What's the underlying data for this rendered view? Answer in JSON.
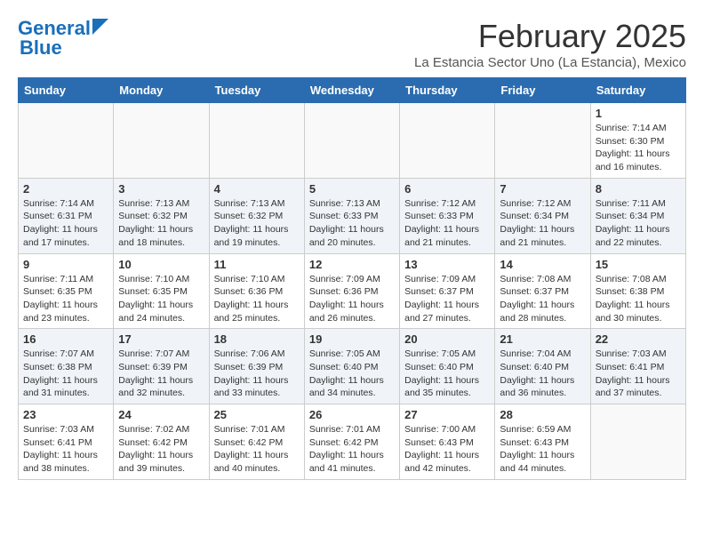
{
  "logo": {
    "line1": "General",
    "line2": "Blue"
  },
  "title": "February 2025",
  "location": "La Estancia Sector Uno (La Estancia), Mexico",
  "days_of_week": [
    "Sunday",
    "Monday",
    "Tuesday",
    "Wednesday",
    "Thursday",
    "Friday",
    "Saturday"
  ],
  "weeks": [
    [
      {
        "day": "",
        "info": ""
      },
      {
        "day": "",
        "info": ""
      },
      {
        "day": "",
        "info": ""
      },
      {
        "day": "",
        "info": ""
      },
      {
        "day": "",
        "info": ""
      },
      {
        "day": "",
        "info": ""
      },
      {
        "day": "1",
        "info": "Sunrise: 7:14 AM\nSunset: 6:30 PM\nDaylight: 11 hours\nand 16 minutes."
      }
    ],
    [
      {
        "day": "2",
        "info": "Sunrise: 7:14 AM\nSunset: 6:31 PM\nDaylight: 11 hours\nand 17 minutes."
      },
      {
        "day": "3",
        "info": "Sunrise: 7:13 AM\nSunset: 6:32 PM\nDaylight: 11 hours\nand 18 minutes."
      },
      {
        "day": "4",
        "info": "Sunrise: 7:13 AM\nSunset: 6:32 PM\nDaylight: 11 hours\nand 19 minutes."
      },
      {
        "day": "5",
        "info": "Sunrise: 7:13 AM\nSunset: 6:33 PM\nDaylight: 11 hours\nand 20 minutes."
      },
      {
        "day": "6",
        "info": "Sunrise: 7:12 AM\nSunset: 6:33 PM\nDaylight: 11 hours\nand 21 minutes."
      },
      {
        "day": "7",
        "info": "Sunrise: 7:12 AM\nSunset: 6:34 PM\nDaylight: 11 hours\nand 21 minutes."
      },
      {
        "day": "8",
        "info": "Sunrise: 7:11 AM\nSunset: 6:34 PM\nDaylight: 11 hours\nand 22 minutes."
      }
    ],
    [
      {
        "day": "9",
        "info": "Sunrise: 7:11 AM\nSunset: 6:35 PM\nDaylight: 11 hours\nand 23 minutes."
      },
      {
        "day": "10",
        "info": "Sunrise: 7:10 AM\nSunset: 6:35 PM\nDaylight: 11 hours\nand 24 minutes."
      },
      {
        "day": "11",
        "info": "Sunrise: 7:10 AM\nSunset: 6:36 PM\nDaylight: 11 hours\nand 25 minutes."
      },
      {
        "day": "12",
        "info": "Sunrise: 7:09 AM\nSunset: 6:36 PM\nDaylight: 11 hours\nand 26 minutes."
      },
      {
        "day": "13",
        "info": "Sunrise: 7:09 AM\nSunset: 6:37 PM\nDaylight: 11 hours\nand 27 minutes."
      },
      {
        "day": "14",
        "info": "Sunrise: 7:08 AM\nSunset: 6:37 PM\nDaylight: 11 hours\nand 28 minutes."
      },
      {
        "day": "15",
        "info": "Sunrise: 7:08 AM\nSunset: 6:38 PM\nDaylight: 11 hours\nand 30 minutes."
      }
    ],
    [
      {
        "day": "16",
        "info": "Sunrise: 7:07 AM\nSunset: 6:38 PM\nDaylight: 11 hours\nand 31 minutes."
      },
      {
        "day": "17",
        "info": "Sunrise: 7:07 AM\nSunset: 6:39 PM\nDaylight: 11 hours\nand 32 minutes."
      },
      {
        "day": "18",
        "info": "Sunrise: 7:06 AM\nSunset: 6:39 PM\nDaylight: 11 hours\nand 33 minutes."
      },
      {
        "day": "19",
        "info": "Sunrise: 7:05 AM\nSunset: 6:40 PM\nDaylight: 11 hours\nand 34 minutes."
      },
      {
        "day": "20",
        "info": "Sunrise: 7:05 AM\nSunset: 6:40 PM\nDaylight: 11 hours\nand 35 minutes."
      },
      {
        "day": "21",
        "info": "Sunrise: 7:04 AM\nSunset: 6:40 PM\nDaylight: 11 hours\nand 36 minutes."
      },
      {
        "day": "22",
        "info": "Sunrise: 7:03 AM\nSunset: 6:41 PM\nDaylight: 11 hours\nand 37 minutes."
      }
    ],
    [
      {
        "day": "23",
        "info": "Sunrise: 7:03 AM\nSunset: 6:41 PM\nDaylight: 11 hours\nand 38 minutes."
      },
      {
        "day": "24",
        "info": "Sunrise: 7:02 AM\nSunset: 6:42 PM\nDaylight: 11 hours\nand 39 minutes."
      },
      {
        "day": "25",
        "info": "Sunrise: 7:01 AM\nSunset: 6:42 PM\nDaylight: 11 hours\nand 40 minutes."
      },
      {
        "day": "26",
        "info": "Sunrise: 7:01 AM\nSunset: 6:42 PM\nDaylight: 11 hours\nand 41 minutes."
      },
      {
        "day": "27",
        "info": "Sunrise: 7:00 AM\nSunset: 6:43 PM\nDaylight: 11 hours\nand 42 minutes."
      },
      {
        "day": "28",
        "info": "Sunrise: 6:59 AM\nSunset: 6:43 PM\nDaylight: 11 hours\nand 44 minutes."
      },
      {
        "day": "",
        "info": ""
      }
    ]
  ]
}
